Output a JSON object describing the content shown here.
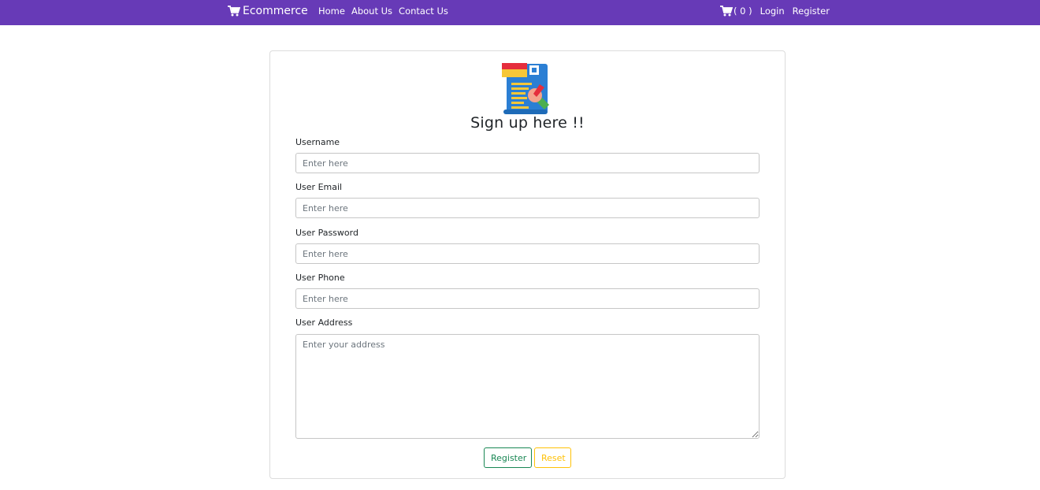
{
  "colors": {
    "navbar": "#673ab7",
    "register_outline": "#198754",
    "reset_outline": "#ffc107"
  },
  "navbar": {
    "brand": "Ecommerce",
    "brand_icon": "cart-icon",
    "links": [
      "Home",
      "About Us",
      "Contact Us"
    ],
    "cart_icon": "cart-icon",
    "cart_count": "( 0 )",
    "login": "Login",
    "register": "Register"
  },
  "form": {
    "logo_icon": "signup-form-icon",
    "title": "Sign up here !!",
    "fields": [
      {
        "label": "Username",
        "placeholder": "Enter here",
        "value": ""
      },
      {
        "label": "User Email",
        "placeholder": "Enter here",
        "value": ""
      },
      {
        "label": "User Password",
        "placeholder": "Enter here",
        "value": ""
      },
      {
        "label": "User Phone",
        "placeholder": "Enter here",
        "value": ""
      }
    ],
    "address": {
      "label": "User Address",
      "placeholder": "Enter your address",
      "value": ""
    },
    "register_button": "Register",
    "reset_button": "Reset"
  }
}
